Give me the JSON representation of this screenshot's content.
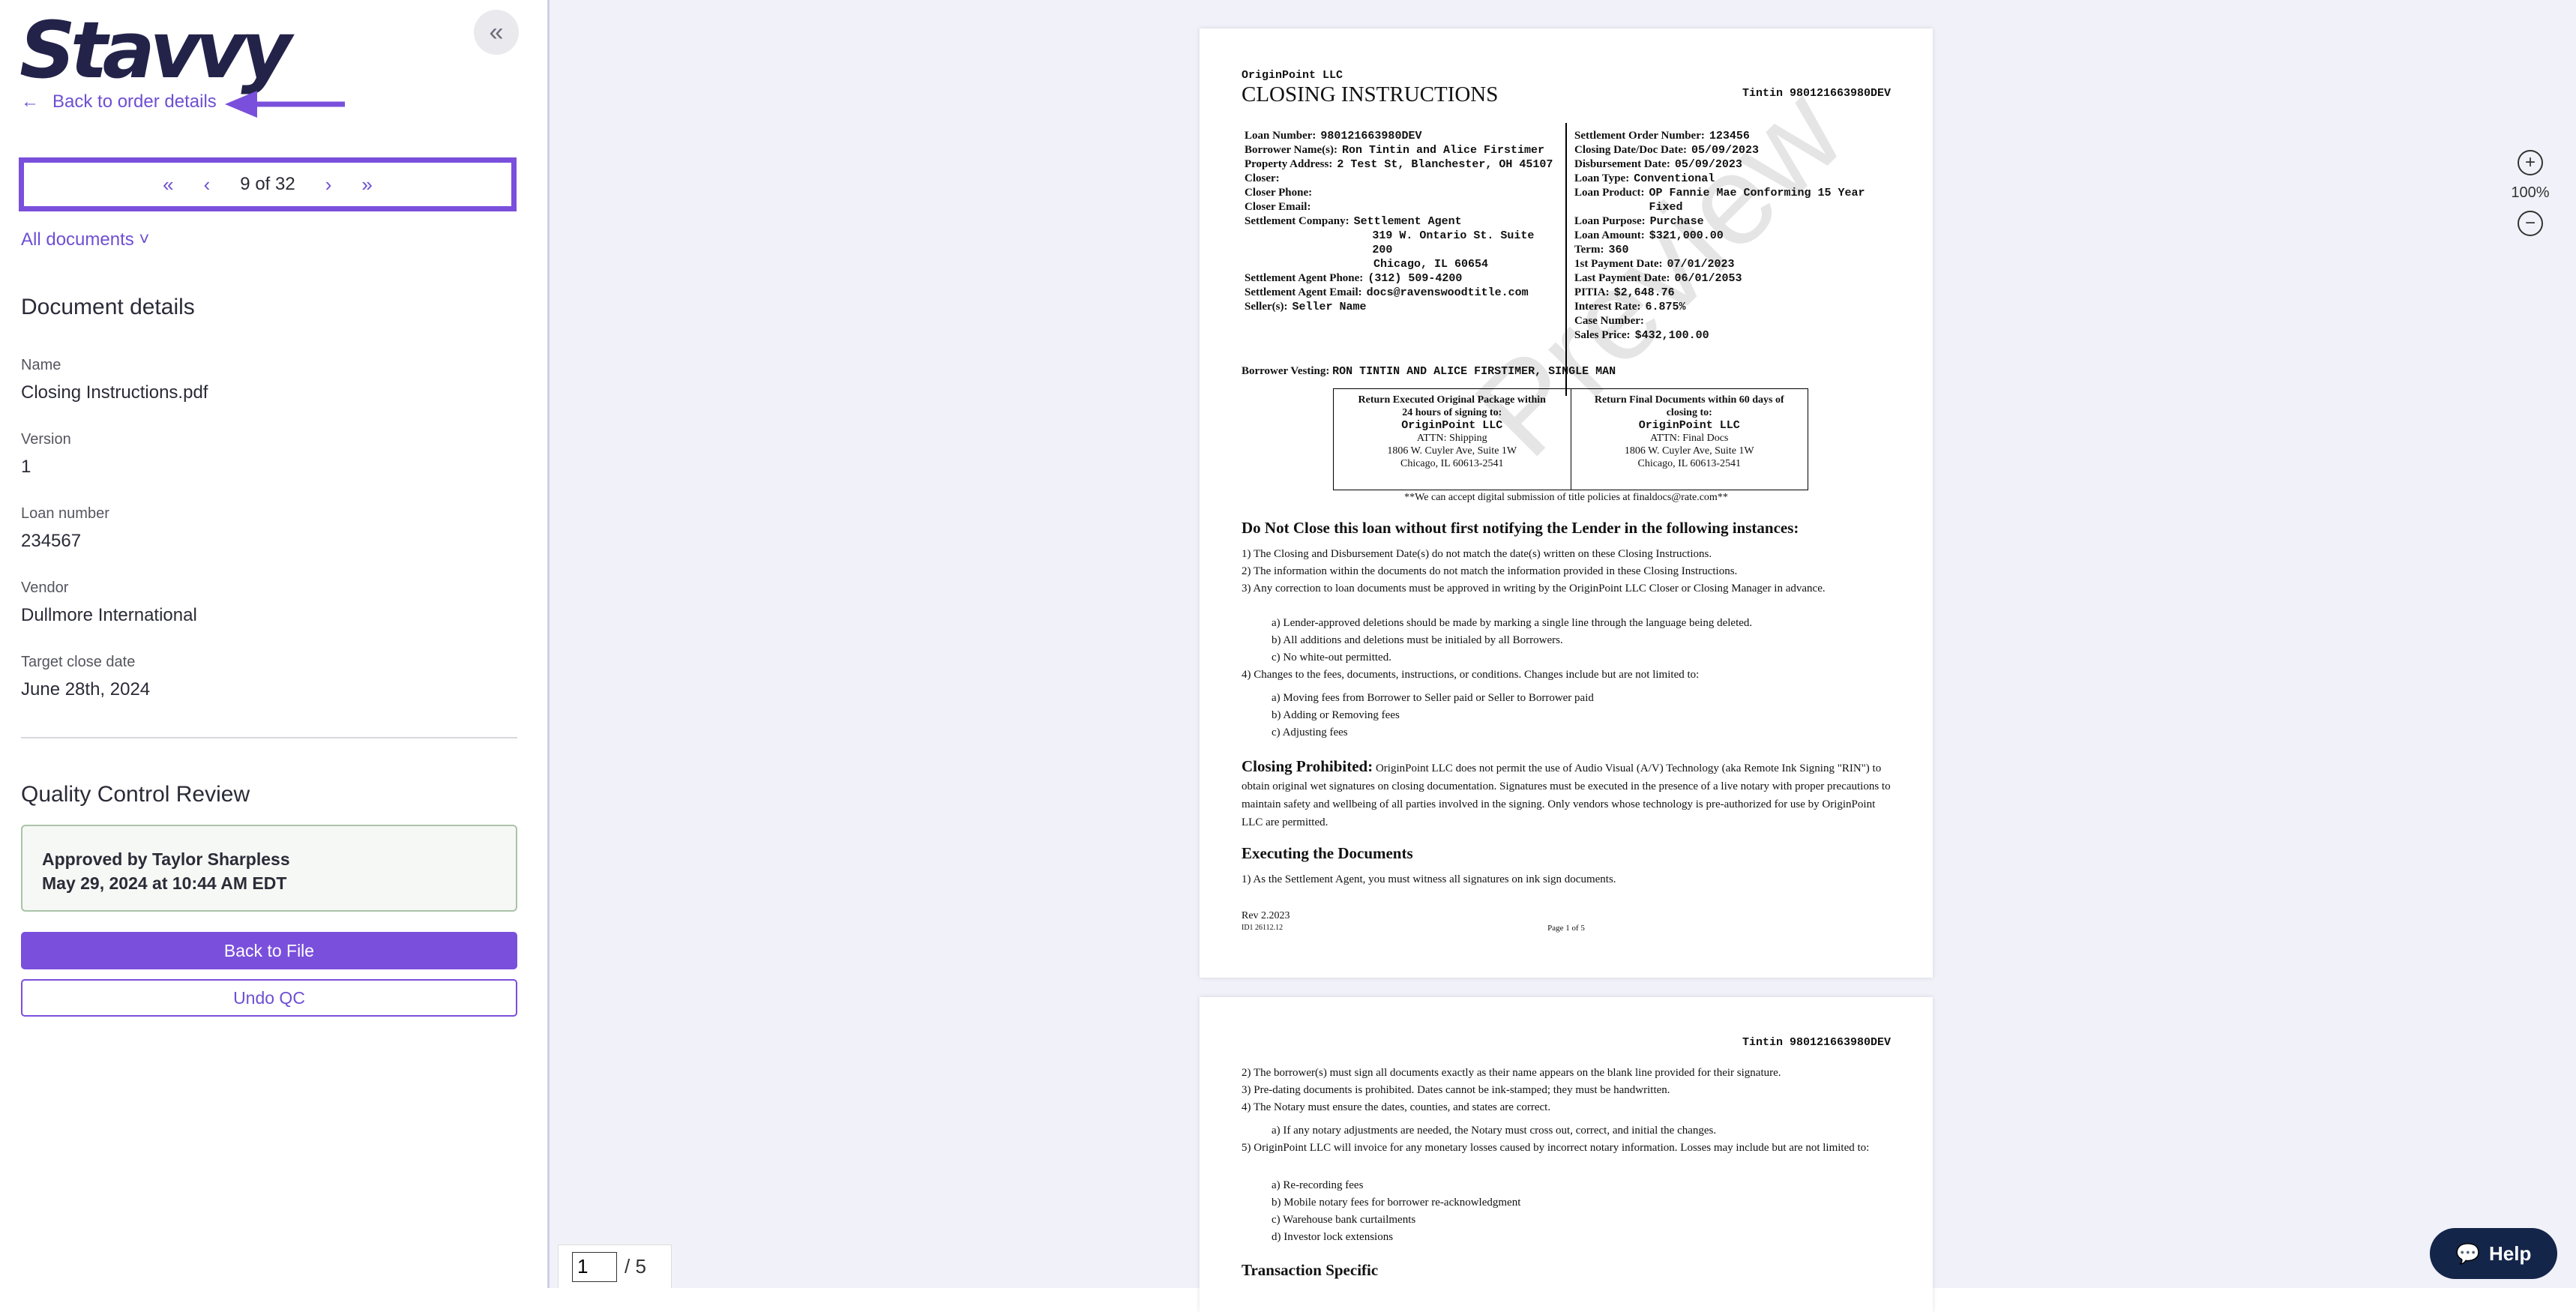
{
  "brand": {
    "name": "Stavvy"
  },
  "nav": {
    "back_label": "Back to order details",
    "collapse_icon": "double-chevron-left-icon"
  },
  "pager": {
    "text": "9 of 32"
  },
  "docs_menu": {
    "label": "All documents"
  },
  "details": {
    "heading": "Document details",
    "name_label": "Name",
    "name_value": "Closing Instructions.pdf",
    "version_label": "Version",
    "version_value": "1",
    "loan_label": "Loan number",
    "loan_value": "234567",
    "vendor_label": "Vendor",
    "vendor_value": "Dullmore International",
    "close_label": "Target close date",
    "close_value": "June 28th, 2024"
  },
  "qc": {
    "heading": "Quality Control Review",
    "approved_line1": "Approved by Taylor Sharpless",
    "approved_line2": "May 29, 2024 at 10:44 AM EDT",
    "back_to_file": "Back to File",
    "undo": "Undo QC"
  },
  "viewer": {
    "zoom": "100%",
    "current_page": "1",
    "total_pages": "/ 5",
    "help": "Help",
    "watermark": "Preview"
  },
  "doc": {
    "company": "OriginPoint LLC",
    "title": "CLOSING INSTRUCTIONS",
    "header_id": "Tintin 980121663980DEV",
    "left": [
      {
        "k": "Loan Number:",
        "v": "980121663980DEV"
      },
      {
        "k": "Borrower Name(s):",
        "v": "Ron Tintin and Alice Firstimer"
      },
      {
        "k": "Property Address:",
        "v": "2 Test St, Blanchester, OH 45107"
      },
      {
        "k": "Closer:",
        "v": ""
      },
      {
        "k": "Closer Phone:",
        "v": ""
      },
      {
        "k": "Closer Email:",
        "v": ""
      },
      {
        "k": "Settlement Company:",
        "v": "Settlement Agent"
      },
      {
        "k": "",
        "v": "319 W. Ontario St. Suite 200"
      },
      {
        "k": "",
        "v": "Chicago, IL 60654"
      },
      {
        "k": "Settlement Agent Phone:",
        "v": "(312) 509-4200"
      },
      {
        "k": "Settlement Agent Email:",
        "v": "docs@ravenswoodtitle.com"
      },
      {
        "k": "Seller(s):",
        "v": "Seller Name"
      }
    ],
    "right": [
      {
        "k": "Settlement Order Number:",
        "v": "123456"
      },
      {
        "k": "Closing Date/Doc Date:",
        "v": "05/09/2023"
      },
      {
        "k": "Disbursement Date:",
        "v": "05/09/2023"
      },
      {
        "k": "Loan Type:",
        "v": "Conventional"
      },
      {
        "k": "Loan Product:",
        "v": "OP Fannie Mae Conforming 15 Year Fixed"
      },
      {
        "k": "Loan Purpose:",
        "v": "Purchase"
      },
      {
        "k": "Loan Amount:",
        "v": "$321,000.00"
      },
      {
        "k": "Term:",
        "v": "360"
      },
      {
        "k": "1st Payment Date:",
        "v": "07/01/2023"
      },
      {
        "k": "Last Payment Date:",
        "v": "06/01/2053"
      },
      {
        "k": "PITIA:",
        "v": "$2,648.76"
      },
      {
        "k": "Interest Rate:",
        "v": "6.875%"
      },
      {
        "k": "Case Number:",
        "v": ""
      },
      {
        "k": "Sales Price:",
        "v": "$432,100.00"
      }
    ],
    "vesting_label": "Borrower Vesting:",
    "vesting_value": "RON TINTIN AND ALICE FIRSTIMER, SINGLE MAN",
    "box_left": [
      "Return Executed Original Package within",
      "24 hours of signing to:",
      "OriginPoint LLC",
      "ATTN: Shipping",
      "1806 W. Cuyler Ave, Suite 1W",
      "Chicago, IL 60613-2541"
    ],
    "box_right": [
      "Return Final Documents within 60 days of",
      "closing to:",
      "OriginPoint LLC",
      "ATTN: Final Docs",
      "1806 W. Cuyler Ave, Suite 1W",
      "Chicago, IL 60613-2541"
    ],
    "digital_note": "**We can accept digital submission of title policies at finaldocs@rate.com**",
    "do_not_close": "Do Not Close this loan without first notifying the Lender in the following instances:",
    "list1": [
      "1)   The Closing and Disbursement Date(s) do not match the date(s) written on these Closing Instructions.",
      "2)   The information within the documents do not match the information provided in these Closing Instructions.",
      "3)   Any correction to loan documents must be approved in writing by the OriginPoint LLC Closer or Closing Manager in advance."
    ],
    "list1_sub": [
      "a)   Lender-approved deletions should be made by marking a single line through the language being deleted.",
      "b)   All additions and deletions must be initialed by all Borrowers.",
      "c)   No white-out permitted."
    ],
    "item4": "4)   Changes to the fees, documents, instructions, or conditions. Changes include but are not limited to:",
    "item4_sub": [
      "a)   Moving fees from Borrower to Seller paid or Seller to Borrower paid",
      "b)   Adding or Removing fees",
      "c)   Adjusting fees"
    ],
    "prohibited_title": "Closing Prohibited:",
    "prohibited_text": "OriginPoint LLC does not permit the use of Audio Visual (A/V) Technology (aka Remote Ink Signing \"RIN\") to obtain original wet signatures on closing documentation. Signatures must be executed in the presence of a live notary with proper precautions to maintain safety and wellbeing of all parties involved in the signing. Only vendors whose technology is pre-authorized for use by OriginPoint LLC are permitted.",
    "executing_title": "Executing the Documents",
    "executing_1": "1)   As the Settlement Agent, you must witness all signatures on ink sign documents.",
    "rev": "Rev 2.2023",
    "footer_code": "ID1     26112.12",
    "page_of": "Page 1 of 5",
    "p2_list": [
      "2)   The borrower(s) must sign all documents exactly as their name appears on the blank line provided for their signature.",
      "3)   Pre-dating documents is prohibited. Dates cannot be ink-stamped; they must be handwritten.",
      "4)   The Notary must ensure the dates, counties, and states are correct."
    ],
    "p2_sub4": "a)   If any notary adjustments are needed, the Notary must cross out, correct, and initial the changes.",
    "p2_item5": "5)   OriginPoint LLC will invoice for any monetary losses caused by incorrect notary information. Losses may include but are not limited to:",
    "p2_sub5": [
      "a)   Re-recording fees",
      "b)   Mobile notary fees for borrower re-acknowledgment",
      "c)   Warehouse bank curtailments",
      "d)   Investor lock extensions"
    ],
    "transaction_title": "Transaction Specific"
  }
}
